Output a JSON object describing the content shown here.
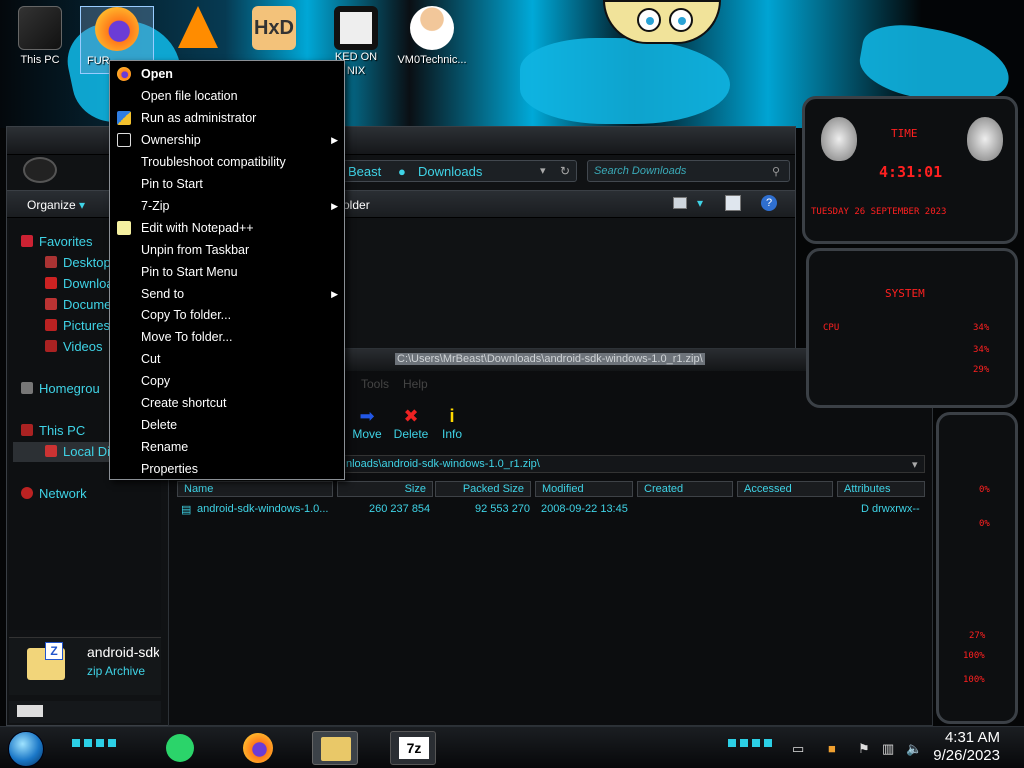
{
  "desktop_icons": [
    {
      "label": "This PC",
      "icon": "computer-icon"
    },
    {
      "label": "FUR",
      "icon": "firefox-icon"
    },
    {
      "label": "",
      "icon": "vlc-icon"
    },
    {
      "label": "",
      "icon": "hxd-icon"
    },
    {
      "label": "KED ON\nNIX",
      "icon": "app-icon"
    },
    {
      "label": "VM0Technic...",
      "icon": "user-doctor-icon"
    }
  ],
  "context_menu": {
    "items": [
      {
        "label": "Open",
        "bold": true,
        "icon": "firefox-icon",
        "submenu": false
      },
      {
        "label": "Open file location",
        "submenu": false
      },
      {
        "label": "Run as administrator",
        "icon": "shield-icon",
        "submenu": false
      },
      {
        "label": "Ownership",
        "icon": "cmd-icon",
        "submenu": true
      },
      {
        "label": "Troubleshoot compatibility",
        "submenu": false
      },
      {
        "label": "Pin to Start",
        "submenu": false
      },
      {
        "label": "7-Zip",
        "submenu": true
      },
      {
        "label": "Edit with Notepad++",
        "icon": "notepadpp-icon",
        "submenu": false
      },
      {
        "label": "Unpin from Taskbar",
        "submenu": false
      },
      {
        "label": "Pin to Start Menu",
        "submenu": false
      },
      {
        "label": "Send to",
        "submenu": true
      },
      {
        "label": "Copy To folder...",
        "submenu": false
      },
      {
        "label": "Move To folder...",
        "submenu": false
      },
      {
        "label": "Cut",
        "submenu": false
      },
      {
        "label": "Copy",
        "submenu": false
      },
      {
        "label": "Create shortcut",
        "submenu": false
      },
      {
        "label": "Delete",
        "submenu": false
      },
      {
        "label": "Rename",
        "submenu": false
      },
      {
        "label": "Properties",
        "submenu": false
      }
    ]
  },
  "explorer": {
    "address": {
      "crumb1": "Beast",
      "crumb2": "Downloads"
    },
    "search_placeholder": "Search Downloads",
    "organize_label": "Organize",
    "folder_label": "older",
    "nav": {
      "favorites": "Favorites",
      "desktop": "Desktop",
      "downloads": "Downloa",
      "documents": "Documer",
      "pictures": "Pictures",
      "videos": "Videos",
      "homegroup": "Homegrou",
      "this_pc": "This PC",
      "local_disk": "Local Dis",
      "network": "Network"
    },
    "details": {
      "name": "android-sdk",
      "type": "zip Archive"
    }
  },
  "sevenzip": {
    "title": "C:\\Users\\MrBeast\\Downloads\\android-sdk-windows-1.0_r1.zip\\",
    "menu": {
      "tools": "Tools",
      "help": "Help"
    },
    "toolbar": {
      "move": "Move",
      "delete": "Delete",
      "info": "Info"
    },
    "path": "nloads\\android-sdk-windows-1.0_r1.zip\\",
    "columns": {
      "name": "Name",
      "size": "Size",
      "packed": "Packed Size",
      "modified": "Modified",
      "created": "Created",
      "accessed": "Accessed",
      "attributes": "Attributes"
    },
    "row": {
      "name": "android-sdk-windows-1.0...",
      "size": "260 237 854",
      "packed": "92 553 270",
      "modified": "2008-09-22 13:45",
      "attributes": "D drwxrwx--"
    }
  },
  "widgets": {
    "time_label": "TIME",
    "time": "4:31:01",
    "date": "TUESDAY 26 SEPTEMBER 2023",
    "system_label": "SYSTEM",
    "cpu_label": "CPU",
    "cpu_values": [
      "34%",
      "34%",
      "29%"
    ],
    "stat_values": [
      "0%",
      "0%",
      "27%",
      "100%",
      "100%"
    ]
  },
  "taskbar": {
    "time": "4:31 AM",
    "date": "9/26/2023"
  },
  "colors": {
    "accent": "#3fd3e6",
    "widget_red": "#ff2020"
  }
}
